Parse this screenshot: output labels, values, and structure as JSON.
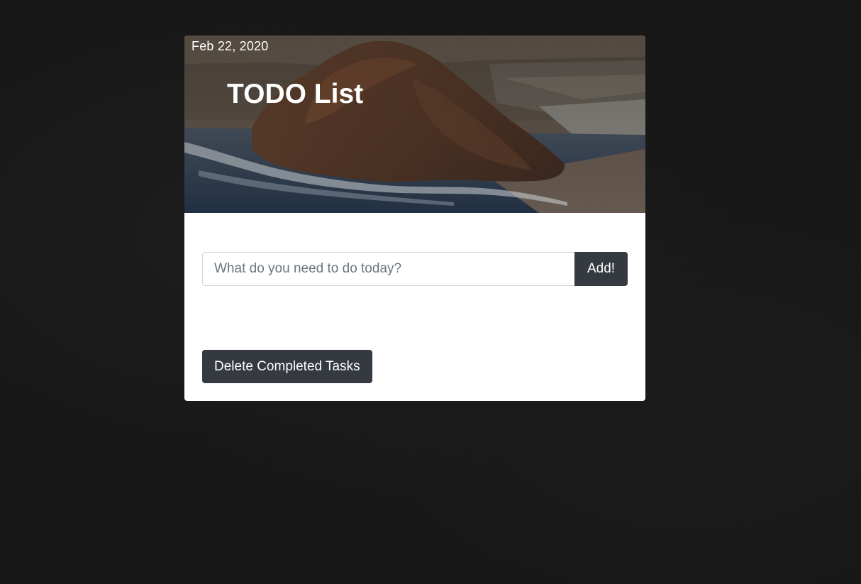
{
  "header": {
    "date": "Feb 22, 2020",
    "title": "TODO List"
  },
  "new_task": {
    "placeholder": "What do you need to do today?",
    "value": "",
    "add_label": "Add!"
  },
  "actions": {
    "delete_completed_label": "Delete Completed Tasks"
  },
  "colors": {
    "page_background": "#171717",
    "card_background": "#ffffff",
    "button_dark": "#343a40",
    "input_border": "#ced4da"
  },
  "icons": {
    "hero_image": "coastal-rock-landscape"
  }
}
